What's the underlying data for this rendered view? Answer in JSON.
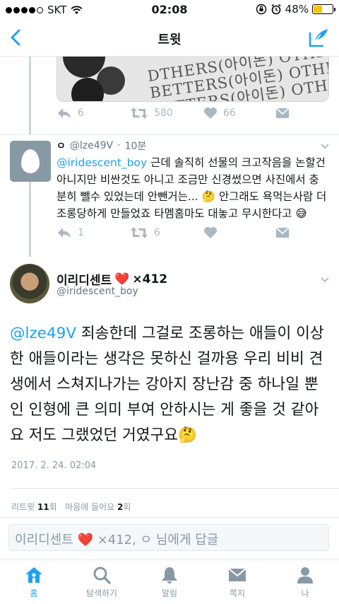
{
  "status_bar": {
    "carrier": "SKT",
    "time": "02:08",
    "battery_percent": "48%",
    "battery_level": 0.48,
    "signal_bars": 4
  },
  "nav": {
    "title": "트윗"
  },
  "previous_tweet": {
    "image_text": [
      "DTHERS(아이돈) OTHER",
      "BETTERS(아이돈) OTHER",
      "BETTERS(아이돈) OTHE"
    ],
    "reply_count": "6",
    "retweet_count": "580",
    "like_count": "66"
  },
  "reply_tweet": {
    "name": "ㅇ",
    "handle": "@lze49V",
    "time": "10분",
    "mention": "@iridescent_boy",
    "text": " 근데 솔직히 선물의 크고작음을 논할건 아니지만 비싼것도 아니고 조금만 신경썼으면 사진에서 충분히 뺄수 있었는데 안뺀거는... 🤔 안그래도 욕먹는사람 더 조롱당하게 만들었죠 타멤홈마도 대놓고 무시한다고 😅",
    "reply_count": "1",
    "retweet_count": "6"
  },
  "main_tweet": {
    "author_name": "이리디센트",
    "heart": "❤️",
    "author_suffix": "×412",
    "handle": "@iridescent_boy",
    "mention": "@lze49V",
    "text": " 죄송한데 그걸로 조롱하는 애들이 이상한 애들이라는 생각은 못하신 걸까용 우리 비비 견생에서 스쳐지나가는 강아지 장난감 중 하나일 뿐인 인형에 큰 의미 부여 안하시는 게 좋을 것 같아요 저도 그랬었던 거였구요🤔",
    "timestamp": "2017. 2. 24. 02:04",
    "retweet_label": "리트윗",
    "retweet_count": "11",
    "count_unit": "회",
    "like_label": "마음에 들어요",
    "like_count": "2"
  },
  "reply_bar": {
    "placeholder": "이리디센트 ❤️ ×412, ㅇ 님에게 답글"
  },
  "tab_bar": {
    "tabs": [
      {
        "label": "홈",
        "icon": "home-icon"
      },
      {
        "label": "탐색하기",
        "icon": "search-icon"
      },
      {
        "label": "알림",
        "icon": "bell-icon"
      },
      {
        "label": "쪽지",
        "icon": "mail-icon"
      },
      {
        "label": "나",
        "icon": "person-icon"
      }
    ]
  },
  "colors": {
    "accent": "#1da1f2",
    "muted": "#aab8c2",
    "text": "#14171a"
  }
}
